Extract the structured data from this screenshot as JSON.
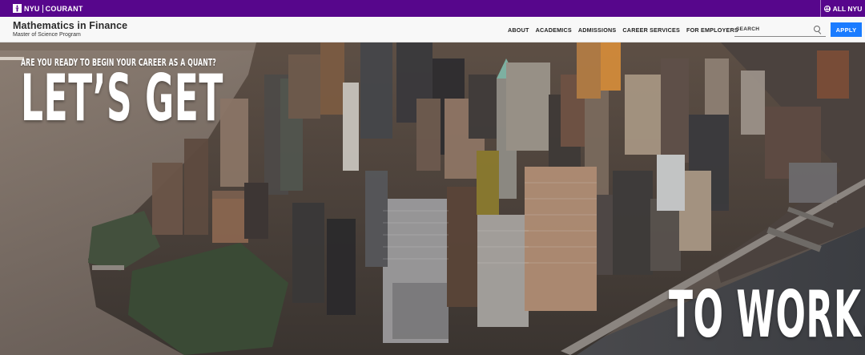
{
  "topbar": {
    "brand_primary": "NYU",
    "brand_secondary": "COURANT",
    "all_nyu_label": "ALL NYU",
    "background_color": "#57068c"
  },
  "header": {
    "title": "Mathematics in Finance",
    "subtitle": "Master of Science Program",
    "nav": [
      "ABOUT",
      "ACADEMICS",
      "ADMISSIONS",
      "CAREER SERVICES",
      "FOR EMPLOYERS"
    ],
    "search_placeholder": "SEARCH",
    "apply_label": "APPLY",
    "apply_color": "#1a7cff"
  },
  "hero": {
    "kicker": "ARE YOU READY TO BEGIN YOUR CAREER AS A QUANT?",
    "line1": "LET’S GET",
    "line2": "TO WORK.",
    "image": "aerial-view-lower-manhattan"
  },
  "icons": [
    "torch-logo-icon",
    "globe-icon",
    "search-icon"
  ]
}
